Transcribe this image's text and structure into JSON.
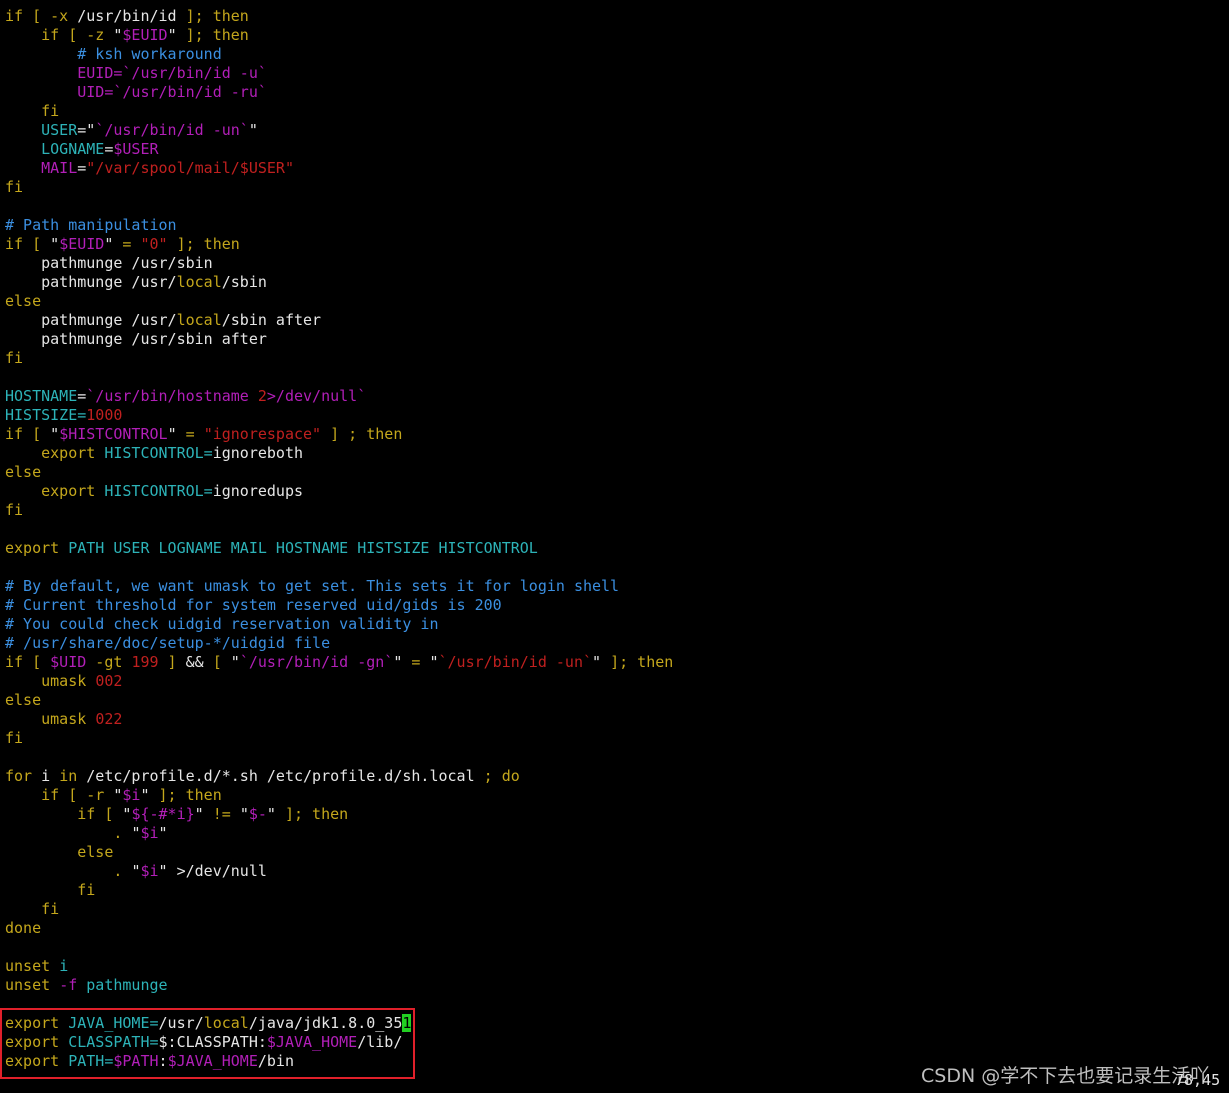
{
  "lines": [
    [
      [
        "y",
        "if [ -x "
      ],
      [
        "w",
        "/usr/bin/id "
      ],
      [
        "y",
        "]; then"
      ]
    ],
    [
      [
        "y",
        "    if [ -z "
      ],
      [
        "w",
        "\""
      ],
      [
        "m",
        "$EUID"
      ],
      [
        "w",
        "\""
      ],
      [
        "y",
        " ]; then"
      ]
    ],
    [
      [
        "b",
        "        # ksh workaround"
      ]
    ],
    [
      [
        "m",
        "        EUID=`/usr/bin/id -u`"
      ]
    ],
    [
      [
        "m",
        "        UID=`/usr/bin/id -ru`"
      ]
    ],
    [
      [
        "y",
        "    fi"
      ]
    ],
    [
      [
        "c",
        "    USER"
      ],
      [
        "w",
        "=\""
      ],
      [
        "m",
        "`/usr/bin/id -un`"
      ],
      [
        "w",
        "\""
      ]
    ],
    [
      [
        "c",
        "    LOGNAME"
      ],
      [
        "w",
        "="
      ],
      [
        "m",
        "$USER"
      ]
    ],
    [
      [
        "m",
        "    MAIL"
      ],
      [
        "w",
        "="
      ],
      [
        "r",
        "\"/var/spool/mail/$USER\""
      ]
    ],
    [
      [
        "y",
        "fi"
      ]
    ],
    [],
    [
      [
        "b",
        "# Path manipulation"
      ]
    ],
    [
      [
        "y",
        "if [ "
      ],
      [
        "w",
        "\""
      ],
      [
        "m",
        "$EUID"
      ],
      [
        "w",
        "\""
      ],
      [
        "y",
        " = "
      ],
      [
        "r",
        "\"0\""
      ],
      [
        "y",
        " ]; then"
      ]
    ],
    [
      [
        "w",
        "    pathmunge /usr/sbin"
      ]
    ],
    [
      [
        "w",
        "    pathmunge /usr/"
      ],
      [
        "y",
        "local"
      ],
      [
        "w",
        "/sbin"
      ]
    ],
    [
      [
        "y",
        "else"
      ]
    ],
    [
      [
        "w",
        "    pathmunge /usr/"
      ],
      [
        "y",
        "local"
      ],
      [
        "w",
        "/sbin after"
      ]
    ],
    [
      [
        "w",
        "    pathmunge /usr/sbin after"
      ]
    ],
    [
      [
        "y",
        "fi"
      ]
    ],
    [],
    [
      [
        "c",
        "HOSTNAME"
      ],
      [
        "w",
        "="
      ],
      [
        "m",
        "`/usr/bin/hostname "
      ],
      [
        "r",
        "2"
      ],
      [
        "m",
        ">/dev/null`"
      ]
    ],
    [
      [
        "c",
        "HISTSIZE="
      ],
      [
        "r",
        "1000"
      ]
    ],
    [
      [
        "y",
        "if [ "
      ],
      [
        "w",
        "\""
      ],
      [
        "m",
        "$HISTCONTROL"
      ],
      [
        "w",
        "\""
      ],
      [
        "y",
        " = "
      ],
      [
        "r",
        "\"ignorespace\""
      ],
      [
        "y",
        " ] ; then"
      ]
    ],
    [
      [
        "y",
        "    export "
      ],
      [
        "c",
        "HISTCONTROL="
      ],
      [
        "w",
        "ignoreboth"
      ]
    ],
    [
      [
        "y",
        "else"
      ]
    ],
    [
      [
        "y",
        "    export "
      ],
      [
        "c",
        "HISTCONTROL="
      ],
      [
        "w",
        "ignoredups"
      ]
    ],
    [
      [
        "y",
        "fi"
      ]
    ],
    [],
    [
      [
        "y",
        "export "
      ],
      [
        "c",
        "PATH USER LOGNAME MAIL HOSTNAME HISTSIZE HISTCONTROL"
      ]
    ],
    [],
    [
      [
        "b",
        "# By default, we want umask to get set. This sets it for login shell"
      ]
    ],
    [
      [
        "b",
        "# Current threshold for system reserved uid/gids is 200"
      ]
    ],
    [
      [
        "b",
        "# You could check uidgid reservation validity in"
      ]
    ],
    [
      [
        "b",
        "# /usr/share/doc/setup-*/uidgid file"
      ]
    ],
    [
      [
        "y",
        "if [ "
      ],
      [
        "m",
        "$UID"
      ],
      [
        "y",
        " -gt "
      ],
      [
        "r",
        "199"
      ],
      [
        "y",
        " ] "
      ],
      [
        "w",
        "&&"
      ],
      [
        "y",
        " [ "
      ],
      [
        "w",
        "\""
      ],
      [
        "m",
        "`/usr/bin/id -gn`"
      ],
      [
        "w",
        "\""
      ],
      [
        "y",
        " = "
      ],
      [
        "w",
        "\""
      ],
      [
        "r",
        "`/usr/bin/id -un`"
      ],
      [
        "w",
        "\""
      ],
      [
        "y",
        " ]; then"
      ]
    ],
    [
      [
        "y",
        "    umask "
      ],
      [
        "r",
        "002"
      ]
    ],
    [
      [
        "y",
        "else"
      ]
    ],
    [
      [
        "y",
        "    umask "
      ],
      [
        "r",
        "022"
      ]
    ],
    [
      [
        "y",
        "fi"
      ]
    ],
    [],
    [
      [
        "y",
        "for "
      ],
      [
        "w",
        "i "
      ],
      [
        "y",
        "in "
      ],
      [
        "w",
        "/etc/profile.d/*.sh /etc/profile.d/sh.local "
      ],
      [
        "y",
        "; do"
      ]
    ],
    [
      [
        "y",
        "    if [ -r "
      ],
      [
        "w",
        "\""
      ],
      [
        "m",
        "$i"
      ],
      [
        "w",
        "\""
      ],
      [
        "y",
        " ]; then"
      ]
    ],
    [
      [
        "y",
        "        if [ "
      ],
      [
        "w",
        "\""
      ],
      [
        "m",
        "${-#*i}"
      ],
      [
        "w",
        "\""
      ],
      [
        "y",
        " != "
      ],
      [
        "w",
        "\""
      ],
      [
        "m",
        "$-"
      ],
      [
        "w",
        "\""
      ],
      [
        "y",
        " ]; then"
      ]
    ],
    [
      [
        "y",
        "            . "
      ],
      [
        "w",
        "\""
      ],
      [
        "m",
        "$i"
      ],
      [
        "w",
        "\""
      ]
    ],
    [
      [
        "y",
        "        else"
      ]
    ],
    [
      [
        "y",
        "            . "
      ],
      [
        "w",
        "\""
      ],
      [
        "m",
        "$i"
      ],
      [
        "w",
        "\" >/dev/null"
      ]
    ],
    [
      [
        "y",
        "        fi"
      ]
    ],
    [
      [
        "y",
        "    fi"
      ]
    ],
    [
      [
        "y",
        "done"
      ]
    ],
    [],
    [
      [
        "y",
        "unset "
      ],
      [
        "c",
        "i"
      ]
    ],
    [
      [
        "y",
        "unset "
      ],
      [
        "m",
        "-f "
      ],
      [
        "c",
        "pathmunge"
      ]
    ],
    [],
    [
      [
        "y",
        "export "
      ],
      [
        "c",
        "JAVA_HOME="
      ],
      [
        "w",
        "/usr/"
      ],
      [
        "y",
        "local"
      ],
      [
        "w",
        "/java/jdk1.8.0_35"
      ],
      [
        "cur",
        "1"
      ]
    ],
    [
      [
        "y",
        "export "
      ],
      [
        "c",
        "CLASSPATH="
      ],
      [
        "w",
        "$:CLASSPATH:"
      ],
      [
        "m",
        "$JAVA_HOME"
      ],
      [
        "w",
        "/lib/"
      ]
    ],
    [
      [
        "y",
        "export "
      ],
      [
        "c",
        "PATH="
      ],
      [
        "m",
        "$PATH"
      ],
      [
        "w",
        ":"
      ],
      [
        "m",
        "$JAVA_HOME"
      ],
      [
        "w",
        "/bin"
      ]
    ]
  ],
  "status": {
    "cursor_position": "78,45"
  },
  "watermark": "CSDN @学不下去也要记录生活吖",
  "colors": {
    "background": "#000000",
    "keyword": "#c4a71c",
    "variable": "#2db3b8",
    "special": "#b21fb8",
    "string": "#c0201f",
    "comment": "#3b8fe0",
    "cursor": "#22d022",
    "highlight_box": "#e0202a"
  }
}
